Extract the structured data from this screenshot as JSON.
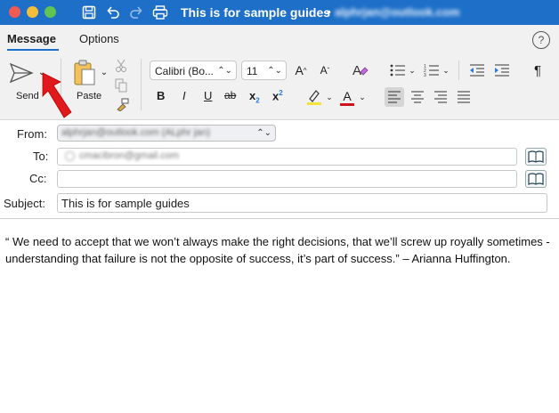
{
  "window": {
    "title": "This is for sample guides",
    "title_separator": "•",
    "account_blurred": "alphrjan@outlook.com"
  },
  "tabs": [
    {
      "label": "Message",
      "active": true
    },
    {
      "label": "Options",
      "active": false
    }
  ],
  "ribbon": {
    "send_label": "Send",
    "paste_label": "Paste",
    "font_name": "Calibri (Bo...",
    "font_size": "11",
    "bold": "B",
    "italic": "I",
    "underline": "U",
    "strike": "ab",
    "subscript": "x",
    "superscript": "x",
    "font_color_letter": "A",
    "highlight_color": "#f5e43a",
    "font_color": "#d0131a"
  },
  "header": {
    "from_label": "From:",
    "from_value": "alphrjan@outlook.com (ALphr jan)",
    "to_label": "To:",
    "to_value": "cmacibron@gmail.com",
    "cc_label": "Cc:",
    "cc_value": "",
    "subject_label": "Subject:",
    "subject_value": "This is for sample guides"
  },
  "body": {
    "text": "“ We need to accept that we won’t always make the right decisions, that we’ll screw up royally sometimes - understanding that failure is not the opposite of success, it’s part of success.” – Arianna Huffington."
  },
  "colors": {
    "titlebar": "#1d6fc8",
    "accent": "#1d6fc8",
    "annotation_arrow": "#e0191c"
  }
}
